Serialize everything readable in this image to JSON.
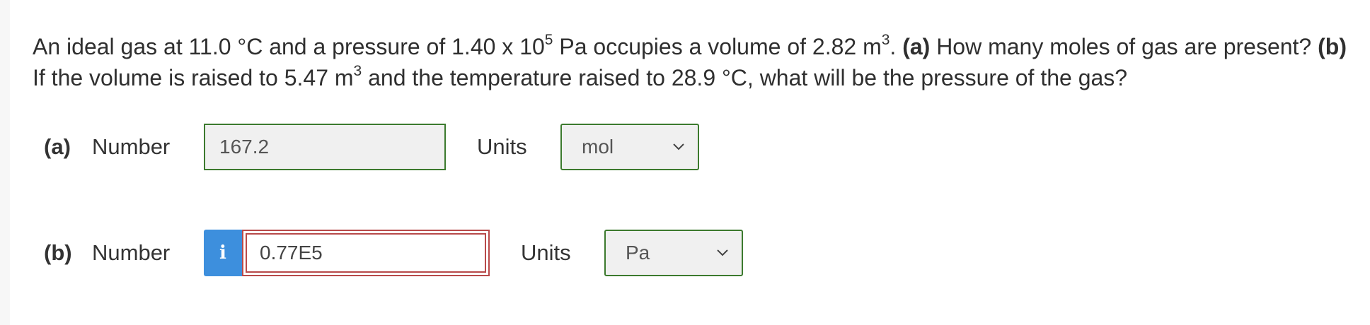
{
  "question": {
    "p1": "An ideal gas at 11.0 °C and a pressure of 1.40 x 10",
    "sup1": "5",
    "p2": " Pa occupies a volume of 2.82 m",
    "sup2": "3",
    "p3": ". ",
    "a_label": "(a)",
    "p4": " How many moles of gas are present? ",
    "b_label": "(b)",
    "p5": " If the volume is raised to 5.47 m",
    "sup3": "3",
    "p6": " and the temperature raised to 28.9 °C, what will be the pressure of the gas?"
  },
  "part_a": {
    "label": "(a)",
    "number_label": "Number",
    "value": "167.2",
    "units_label": "Units",
    "units_value": "mol"
  },
  "part_b": {
    "label": "(b)",
    "number_label": "Number",
    "info_icon": "i",
    "value": "0.77E5",
    "units_label": "Units",
    "units_value": "Pa"
  },
  "colors": {
    "correct_border": "#3c7a2e",
    "incorrect_border": "#b84a4a",
    "info_button": "#3d8fdd"
  },
  "icons": [
    "info-icon",
    "chevron-down-icon"
  ]
}
